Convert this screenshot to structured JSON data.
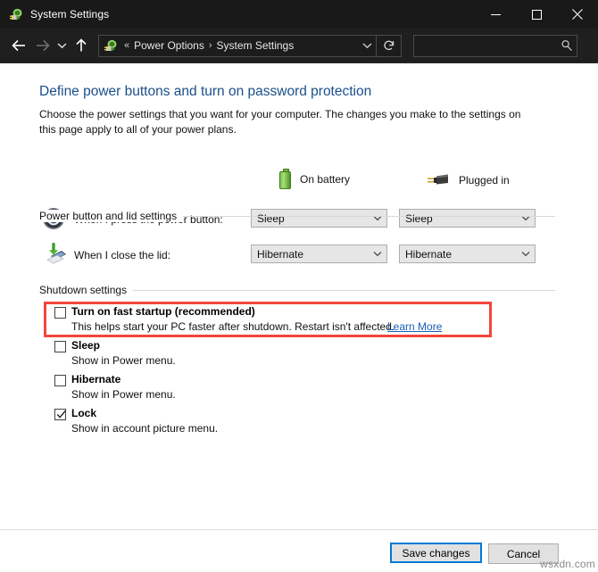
{
  "window": {
    "title": "System Settings",
    "icon": "power-options-icon",
    "minimize_label": "─",
    "maximize_label": "☐",
    "close_label": "✕"
  },
  "toolbar": {
    "back_label": "←",
    "forward_label": "→",
    "recent_label": "˅",
    "up_label": "↑",
    "address": {
      "icon": "power-options-icon",
      "overflow": "«",
      "crumbs": [
        "Power Options",
        "System Settings"
      ],
      "separator": "›",
      "dropdown_label": "˅",
      "refresh_label": "↻"
    },
    "search": {
      "value": "",
      "placeholder": "",
      "icon": "search-icon"
    }
  },
  "page": {
    "title": "Define power buttons and turn on password protection",
    "description": "Choose the power settings that you want for your computer. The changes you make to the settings on this page apply to all of your power plans."
  },
  "sections": {
    "power_lid": {
      "label": "Power button and lid settings",
      "columns": [
        {
          "label": "On battery",
          "icon": "battery-icon"
        },
        {
          "label": "Plugged in",
          "icon": "power-plug-icon"
        }
      ],
      "rows": [
        {
          "icon": "power-button-icon",
          "label": "When I press the power button:",
          "on_battery": "Sleep",
          "plugged_in": "Sleep"
        },
        {
          "icon": "laptop-lid-icon",
          "label": "When I close the lid:",
          "on_battery": "Hibernate",
          "plugged_in": "Hibernate"
        }
      ]
    },
    "shutdown": {
      "label": "Shutdown settings",
      "items": [
        {
          "title": "Turn on fast startup (recommended)",
          "description": "This helps start your PC faster after shutdown. Restart isn't affected.",
          "link": "Learn More",
          "checked": false,
          "highlighted": true
        },
        {
          "title": "Sleep",
          "description": "Show in Power menu.",
          "link": "",
          "checked": false,
          "highlighted": false
        },
        {
          "title": "Hibernate",
          "description": "Show in Power menu.",
          "link": "",
          "checked": false,
          "highlighted": false
        },
        {
          "title": "Lock",
          "description": "Show in account picture menu.",
          "link": "",
          "checked": true,
          "highlighted": false
        }
      ]
    }
  },
  "footer": {
    "save_label": "Save changes",
    "cancel_label": "Cancel"
  },
  "watermark": "wsxdn.com",
  "colors": {
    "titlebar": "#191919",
    "toolbar": "#1f1f1f",
    "heading": "#1a4f8a",
    "link": "#1a5fb4",
    "annotation": "#f4453c",
    "focus": "#0078d7",
    "battery": "#6fb23e"
  }
}
